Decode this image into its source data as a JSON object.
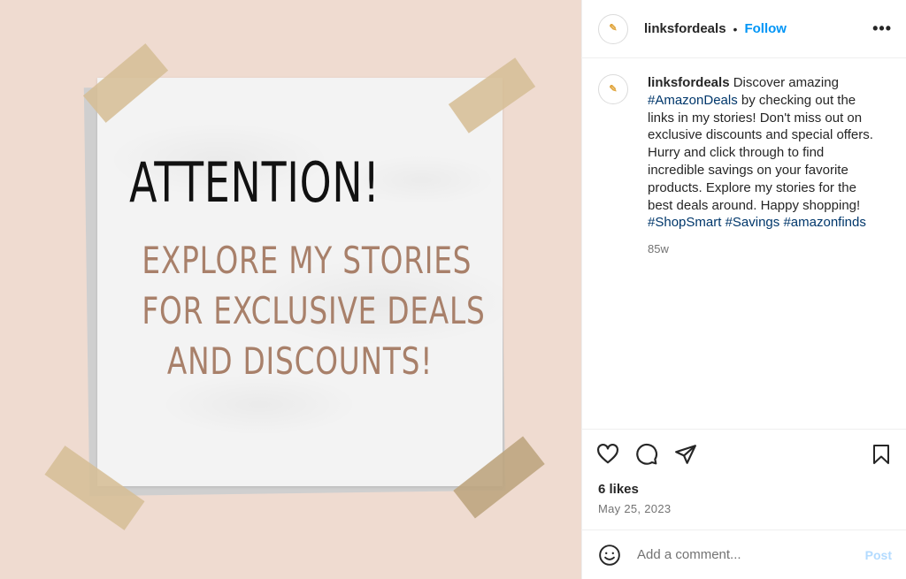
{
  "post_image": {
    "heading": "ATTENTION!",
    "lines": [
      "EXPLORE MY STORIES",
      "FOR EXCLUSIVE DEALS",
      "AND DISCOUNTS!"
    ],
    "colors": {
      "background": "#efdbd0",
      "paper": "#f3f3f3",
      "heading": "#111111",
      "body": "#a8806a",
      "tape": "#d6be96"
    }
  },
  "header": {
    "username": "linksfordeals",
    "separator": "•",
    "follow_label": "Follow",
    "more_label": "•••"
  },
  "caption": {
    "username": "linksfordeals",
    "segments": [
      " Discover amazing ",
      "#AmazonDeals",
      " by checking out the links in my stories! Don't miss out on exclusive discounts and special offers. Hurry and click through to find incredible savings on your favorite products. Explore my stories for the best deals around. Happy shopping! ",
      "#ShopSmart",
      " ",
      "#Savings",
      " ",
      "#amazonfinds"
    ],
    "time_ago": "85w"
  },
  "actions": {
    "like_icon": "heart-icon",
    "comment_icon": "comment-icon",
    "share_icon": "share-icon",
    "save_icon": "bookmark-icon"
  },
  "likes": "6 likes",
  "date": "May 25, 2023",
  "comment_box": {
    "placeholder": "Add a comment...",
    "post_label": "Post"
  },
  "colors": {
    "link": "#0095f6",
    "hashtag": "#00376b",
    "muted": "#737373",
    "post_disabled": "#b3dbff"
  }
}
